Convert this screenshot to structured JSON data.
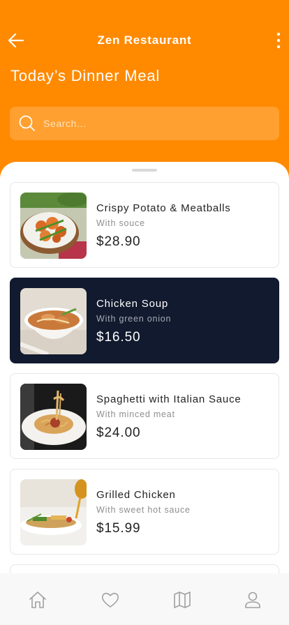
{
  "app_title": "Zen Restaurant",
  "page_title": "Today’s Dinner Meal",
  "search": {
    "placeholder": "Search..."
  },
  "menu_items": [
    {
      "name": "Crispy Potato & Meatballs",
      "subtitle": "With souce",
      "price": "$28.90",
      "selected": false
    },
    {
      "name": "Chicken Soup",
      "subtitle": "With green onion",
      "price": "$16.50",
      "selected": true
    },
    {
      "name": "Spaghetti with Italian Sauce",
      "subtitle": "With minced meat",
      "price": "$24.00",
      "selected": false
    },
    {
      "name": "Grilled Chicken",
      "subtitle": "With sweet hot sauce",
      "price": "$15.99",
      "selected": false
    }
  ],
  "icons": {
    "back": "arrow-left-icon",
    "more": "more-vertical-icon",
    "search": "search-icon",
    "tabs": [
      "home-icon",
      "heart-icon",
      "map-icon",
      "user-icon"
    ]
  },
  "colors": {
    "brand": "#FF8A00",
    "search_bg": "#FFA030",
    "selected_card": "#111A2E",
    "tab_icon": "#A0A0A0"
  }
}
